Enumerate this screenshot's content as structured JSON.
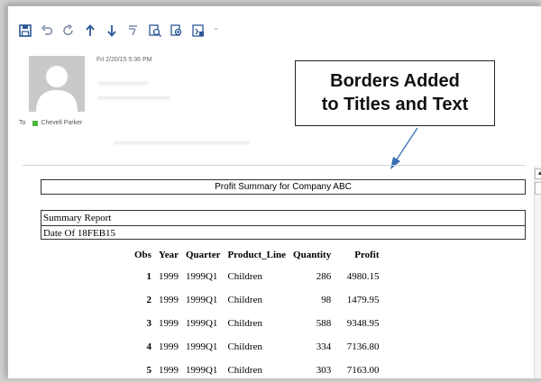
{
  "toolbar": {
    "buttons": [
      "save-icon",
      "undo-icon",
      "redo-icon",
      "up-arrow-icon",
      "down-arrow-icon",
      "format-painter-icon",
      "find-icon",
      "zoom-icon",
      "print-preview-icon"
    ],
    "more_label": "⁼"
  },
  "message": {
    "datetime": "Fri 2/20/15 5:36 PM",
    "to_label": "To",
    "recipient": "Chevell Parker"
  },
  "callout": {
    "line1": "Borders Added",
    "line2": "to Titles and Text"
  },
  "report": {
    "title": "Profit Summary for Company ABC",
    "text_lines": [
      "Summary Report",
      "Date Of 18FEB15"
    ],
    "columns": [
      "Obs",
      "Year",
      "Quarter",
      "Product_Line",
      "Quantity",
      "Profit"
    ],
    "rows": [
      [
        "1",
        "1999",
        "1999Q1",
        "Children",
        "286",
        "4980.15"
      ],
      [
        "2",
        "1999",
        "1999Q1",
        "Children",
        "98",
        "1479.95"
      ],
      [
        "3",
        "1999",
        "1999Q1",
        "Children",
        "588",
        "9348.95"
      ],
      [
        "4",
        "1999",
        "1999Q1",
        "Children",
        "334",
        "7136.80"
      ],
      [
        "5",
        "1999",
        "1999Q1",
        "Children",
        "303",
        "7163.00"
      ]
    ]
  },
  "colors": {
    "toolbar_icon": "#2b5797",
    "presence": "#4cba3b",
    "avatar_bg": "#c9c9c9"
  }
}
